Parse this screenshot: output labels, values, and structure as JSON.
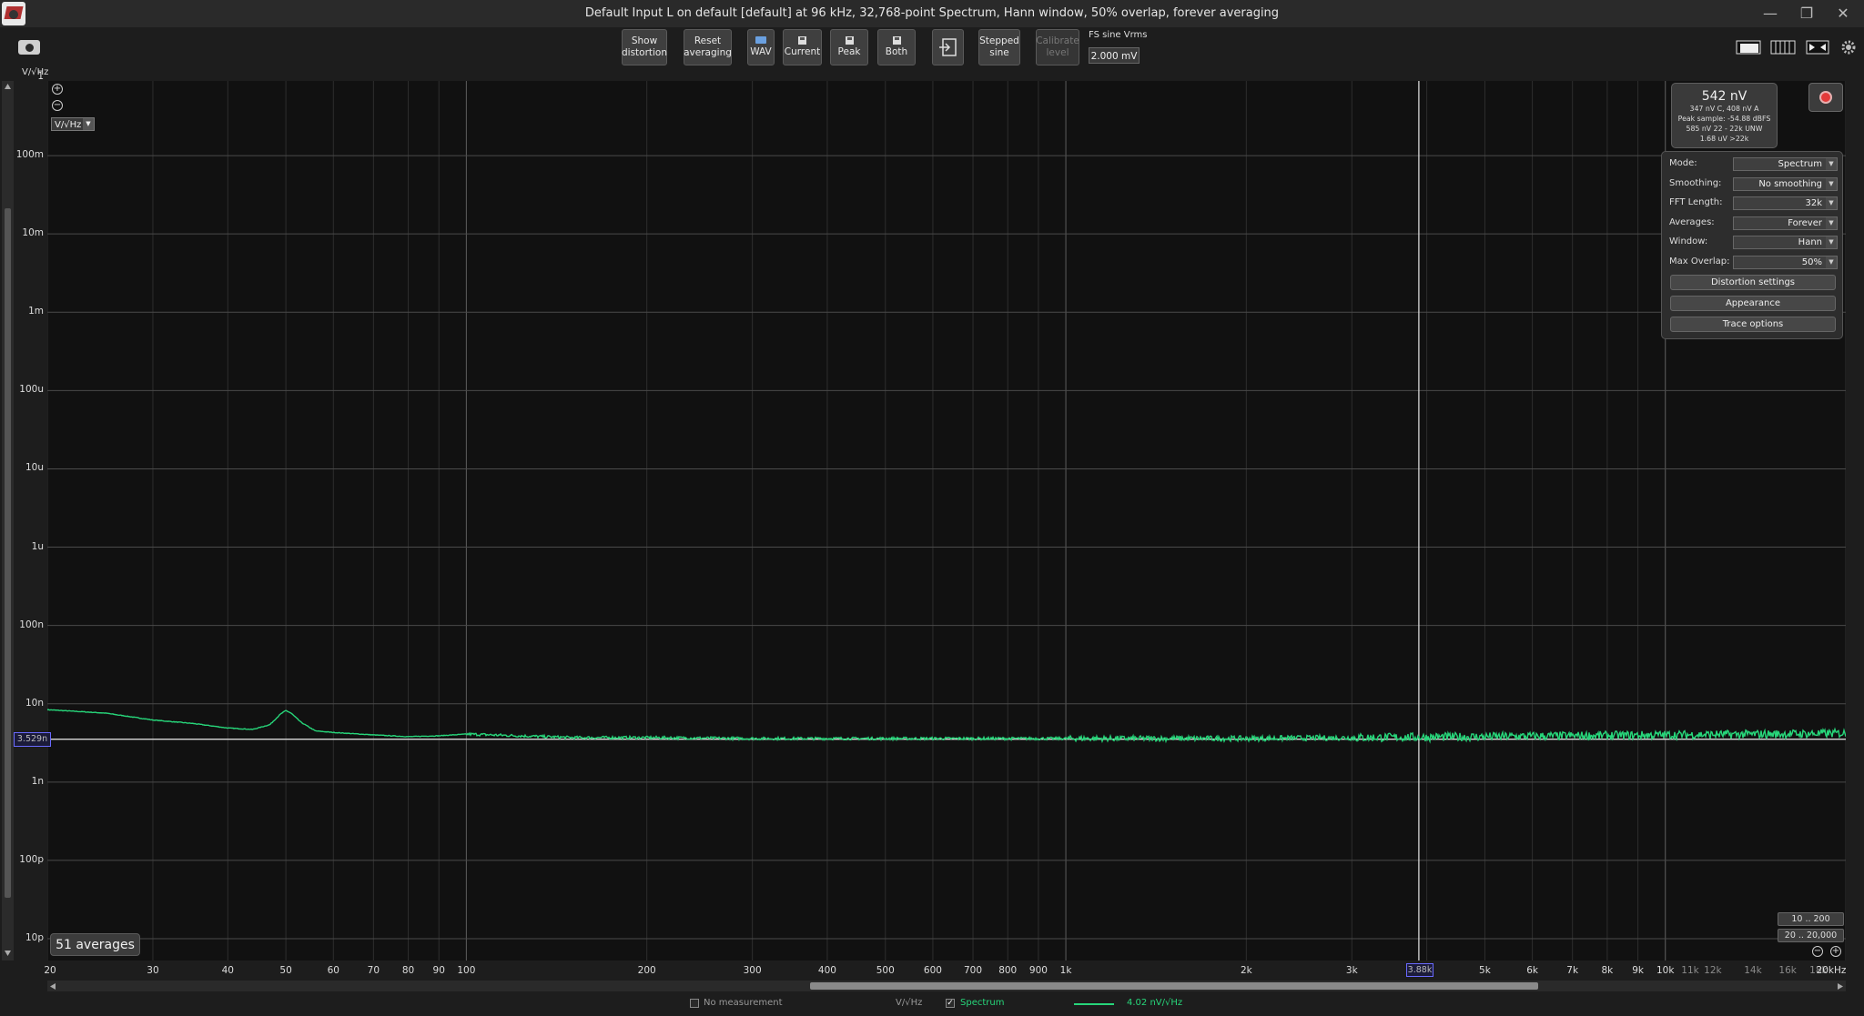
{
  "window": {
    "title": "Default Input L on default [default] at 96 kHz, 32,768-point Spectrum, Hann window, 50% overlap, forever averaging",
    "minimize": "—",
    "restore": "❐",
    "close": "✕"
  },
  "toolbar": {
    "show_distortion": "Show\ndistortion",
    "reset_averaging": "Reset\naveraging",
    "wav": "WAV",
    "current": "Current",
    "peak": "Peak",
    "both": "Both",
    "stepped_sine": "Stepped\nsine",
    "calibrate_level": "Calibrate\nlevel",
    "fs_label": "FS sine Vrms",
    "fs_value": "2.000 mV"
  },
  "plot": {
    "unit_label": "V/√Hz",
    "unit_select": "V/√Hz",
    "y_top_label": "1",
    "y_cursor_readout": "3.529n",
    "x_cursor_readout": "3.88k",
    "averages_badge": "51 averages"
  },
  "meter": {
    "value": "542 nV",
    "line1": "347 nV C, 408 nV A",
    "line2": "Peak sample: -54.88 dBFS",
    "line3": "585 nV 22 - 22k UNW",
    "line4": "1.68 uV >22k"
  },
  "settings": {
    "rows": [
      {
        "label": "Mode:",
        "value": "Spectrum"
      },
      {
        "label": "Smoothing:",
        "value": "No smoothing"
      },
      {
        "label": "FFT Length:",
        "value": "32k"
      },
      {
        "label": "Averages:",
        "value": "Forever"
      },
      {
        "label": "Window:",
        "value": "Hann"
      },
      {
        "label": "Max Overlap:",
        "value": "50%"
      }
    ],
    "distortion_settings": "Distortion settings",
    "appearance": "Appearance",
    "trace_options": "Trace options"
  },
  "range_buttons": {
    "low": "10 .. 200",
    "full": "20 .. 20,000"
  },
  "status": {
    "no_measurement": "No measurement",
    "unit": "V/√Hz",
    "spectrum": "Spectrum",
    "spectrum_value": "4.02 nV/√Hz"
  },
  "colors": {
    "trace": "#27d67a",
    "cursor": "#d8d8d8",
    "grid": "#3d3d3d"
  },
  "chart_data": {
    "type": "line",
    "xlabel": "",
    "ylabel": "V/√Hz",
    "xscale": "log",
    "yscale": "log",
    "xlim": [
      20,
      20000
    ],
    "ylim": [
      1e-11,
      1
    ],
    "grid": true,
    "y_ticks": [
      "1",
      "100m",
      "10m",
      "1m",
      "100u",
      "10u",
      "1u",
      "100n",
      "10n",
      "1n",
      "100p",
      "10p"
    ],
    "x_ticks": [
      {
        "v": 20,
        "l": "20"
      },
      {
        "v": 30,
        "l": "30"
      },
      {
        "v": 40,
        "l": "40"
      },
      {
        "v": 50,
        "l": "50"
      },
      {
        "v": 60,
        "l": "60"
      },
      {
        "v": 70,
        "l": "70"
      },
      {
        "v": 80,
        "l": "80"
      },
      {
        "v": 90,
        "l": "90"
      },
      {
        "v": 100,
        "l": "100"
      },
      {
        "v": 200,
        "l": "200"
      },
      {
        "v": 300,
        "l": "300"
      },
      {
        "v": 400,
        "l": "400"
      },
      {
        "v": 500,
        "l": "500"
      },
      {
        "v": 600,
        "l": "600"
      },
      {
        "v": 700,
        "l": "700"
      },
      {
        "v": 800,
        "l": "800"
      },
      {
        "v": 900,
        "l": "900"
      },
      {
        "v": 1000,
        "l": "1k"
      },
      {
        "v": 2000,
        "l": "2k"
      },
      {
        "v": 3000,
        "l": "3k"
      },
      {
        "v": 5000,
        "l": "5k"
      },
      {
        "v": 6000,
        "l": "6k"
      },
      {
        "v": 7000,
        "l": "7k"
      },
      {
        "v": 8000,
        "l": "8k"
      },
      {
        "v": 9000,
        "l": "9k"
      },
      {
        "v": 10000,
        "l": "10k"
      },
      {
        "v": 11000,
        "l": "11k",
        "dim": true
      },
      {
        "v": 12000,
        "l": "12k",
        "dim": true
      },
      {
        "v": 14000,
        "l": "14k",
        "dim": true
      },
      {
        "v": 16000,
        "l": "16k",
        "dim": true
      },
      {
        "v": 18000,
        "l": "18k",
        "dim": true
      },
      {
        "v": 20000,
        "l": "20kHz"
      }
    ],
    "cursor_x": 3880,
    "cursor_y": 3.529e-09,
    "series": [
      {
        "name": "Spectrum",
        "x": [
          20,
          25,
          30,
          35,
          40,
          44,
          47,
          49,
          50,
          51,
          53,
          56,
          60,
          70,
          80,
          90,
          100,
          150,
          200,
          300,
          500,
          1000,
          2000,
          5000,
          10000,
          15000,
          20000
        ],
        "y": [
          8.4e-09,
          7.6e-09,
          6.2e-09,
          5.6e-09,
          4.9e-09,
          4.7e-09,
          5.4e-09,
          7.4e-09,
          8.2e-09,
          7.6e-09,
          5.8e-09,
          4.5e-09,
          4.3e-09,
          4e-09,
          3.8e-09,
          3.9e-09,
          4.1e-09,
          3.7e-09,
          3.7e-09,
          3.6e-09,
          3.6e-09,
          3.6e-09,
          3.6e-09,
          3.8e-09,
          4e-09,
          4.1e-09,
          4.2e-09
        ]
      }
    ]
  }
}
